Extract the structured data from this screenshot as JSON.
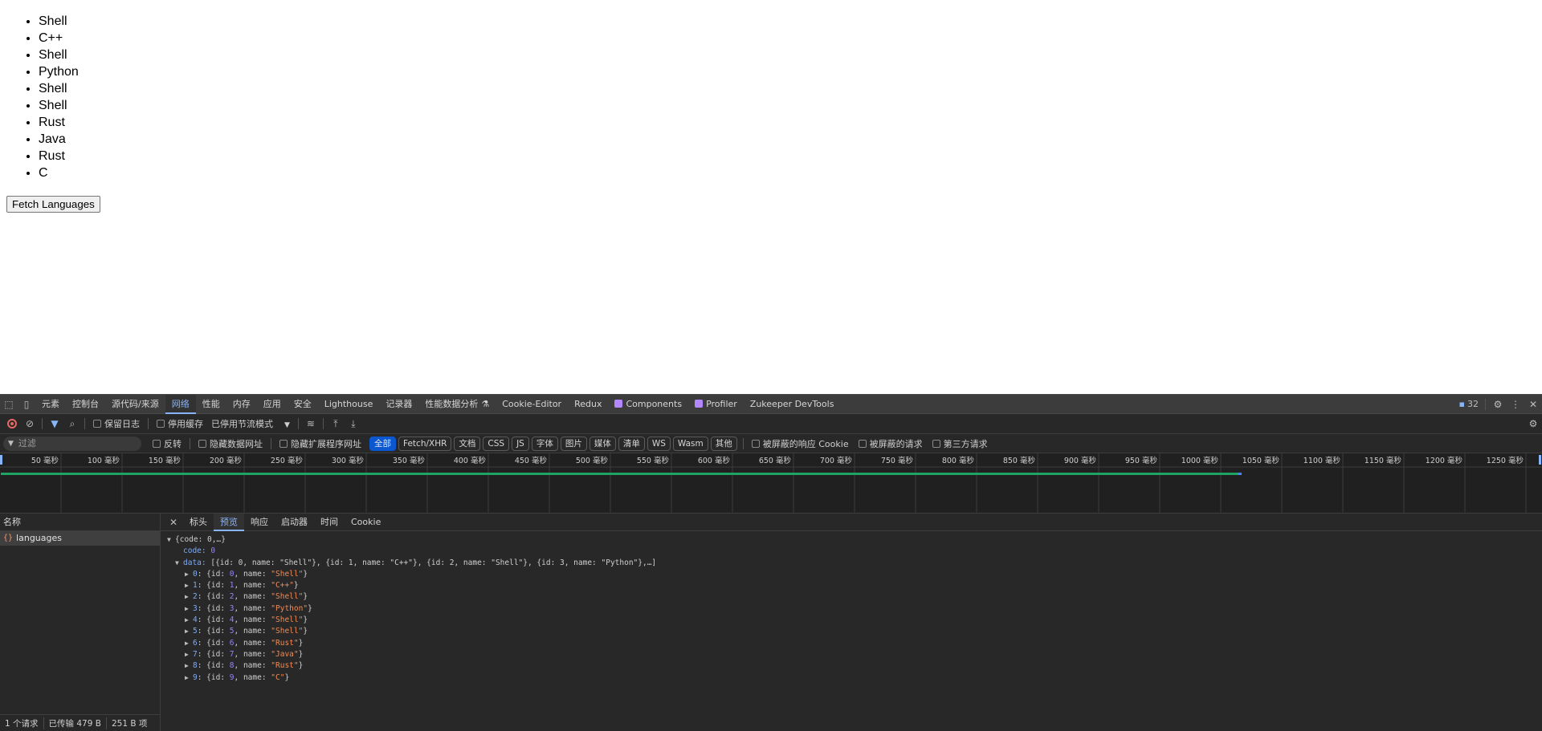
{
  "page": {
    "languages": [
      "Shell",
      "C++",
      "Shell",
      "Python",
      "Shell",
      "Shell",
      "Rust",
      "Java",
      "Rust",
      "C"
    ],
    "fetch_button": "Fetch Languages"
  },
  "devtools": {
    "tabs": [
      "元素",
      "控制台",
      "源代码/来源",
      "网络",
      "性能",
      "内存",
      "应用",
      "安全",
      "Lighthouse",
      "记录器",
      "性能数据分析",
      "Cookie-Editor",
      "Redux",
      "Components",
      "Profiler",
      "Zukeeper DevTools"
    ],
    "active_tab": "网络",
    "issues_count": "32",
    "toolbar": {
      "preserve_log": "保留日志",
      "disable_cache": "停用缓存",
      "throttle": "已停用节流模式"
    },
    "filter": {
      "placeholder": "过滤",
      "invert": "反转",
      "hide_data_urls": "隐藏数据网址",
      "hide_extension_urls": "隐藏扩展程序网址",
      "types": [
        "全部",
        "Fetch/XHR",
        "文档",
        "CSS",
        "JS",
        "字体",
        "图片",
        "媒体",
        "清单",
        "WS",
        "Wasm",
        "其他"
      ],
      "blocked_cookies": "被屏蔽的响应 Cookie",
      "blocked_requests": "被屏蔽的请求",
      "third_party": "第三方请求"
    },
    "timeline_ticks": [
      "50 毫秒",
      "100 毫秒",
      "150 毫秒",
      "200 毫秒",
      "250 毫秒",
      "300 毫秒",
      "350 毫秒",
      "400 毫秒",
      "450 毫秒",
      "500 毫秒",
      "550 毫秒",
      "600 毫秒",
      "650 毫秒",
      "700 毫秒",
      "750 毫秒",
      "800 毫秒",
      "850 毫秒",
      "900 毫秒",
      "950 毫秒",
      "1000 毫秒",
      "1050 毫秒",
      "1100 毫秒",
      "1150 毫秒",
      "1200 毫秒",
      "1250 毫秒"
    ],
    "request_list": {
      "header": "名称",
      "items": [
        "languages"
      ]
    },
    "detail_tabs": [
      "标头",
      "预览",
      "响应",
      "启动器",
      "时间",
      "Cookie"
    ],
    "active_detail_tab": "预览",
    "preview": {
      "root": "{code: 0,…}",
      "code_key": "code",
      "code_val": "0",
      "data_key": "data",
      "data_summary": "[{id: 0, name: \"Shell\"}, {id: 1, name: \"C++\"}, {id: 2, name: \"Shell\"}, {id: 3, name: \"Python\"},…]",
      "items": [
        {
          "index": "0",
          "id": "0",
          "name": "Shell"
        },
        {
          "index": "1",
          "id": "1",
          "name": "C++"
        },
        {
          "index": "2",
          "id": "2",
          "name": "Shell"
        },
        {
          "index": "3",
          "id": "3",
          "name": "Python"
        },
        {
          "index": "4",
          "id": "4",
          "name": "Shell"
        },
        {
          "index": "5",
          "id": "5",
          "name": "Shell"
        },
        {
          "index": "6",
          "id": "6",
          "name": "Rust"
        },
        {
          "index": "7",
          "id": "7",
          "name": "Java"
        },
        {
          "index": "8",
          "id": "8",
          "name": "Rust"
        },
        {
          "index": "9",
          "id": "9",
          "name": "C"
        }
      ]
    },
    "status": {
      "requests": "1 个请求",
      "transferred": "已传输 479 B",
      "resources": "251 B 项"
    },
    "colors": {
      "accent": "#8ab4f8",
      "timeline_bar": "#1ea362",
      "timeline_bar_end": "#4285f4"
    }
  }
}
